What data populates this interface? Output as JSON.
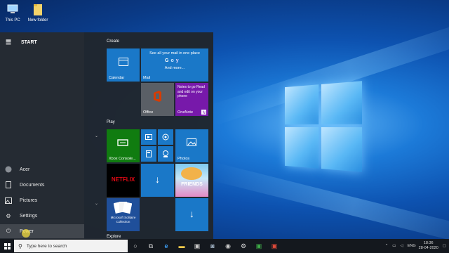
{
  "desktop": {
    "icons": [
      {
        "label": "This PC",
        "icon": "computer-icon"
      },
      {
        "label": "New folder",
        "icon": "folder-icon"
      }
    ]
  },
  "start_menu": {
    "header": "START",
    "rail_items": [
      {
        "label": "Acer",
        "icon": "user-icon"
      },
      {
        "label": "Documents",
        "icon": "document-icon"
      },
      {
        "label": "Pictures",
        "icon": "pictures-icon"
      },
      {
        "label": "Settings",
        "icon": "gear-icon"
      },
      {
        "label": "Power",
        "icon": "power-icon"
      }
    ],
    "groups": {
      "create": "Create",
      "play": "Play",
      "explore": "Explore"
    },
    "tiles": {
      "calendar": "Calendar",
      "mail_heading": "See all your mail in one place",
      "mail_more": "And more...",
      "mail": "Mail",
      "office": "Office",
      "onenote_text": "Notes to go Read and edit on your phone",
      "onenote": "OneNote",
      "xbox": "Xbox Console...",
      "photos": "Photos",
      "netflix": "NETFLIX",
      "friends": "FRIENDS",
      "solitaire": "Microsoft Solitaire Collection"
    }
  },
  "taskbar": {
    "search_placeholder": "Type here to search",
    "language": "ENG",
    "time": "18:36",
    "date": "28-04-2020"
  },
  "colors": {
    "accent": "#1a78c8",
    "office": "#c43e1c",
    "onenote": "#7719aa",
    "xbox": "#107c10"
  }
}
